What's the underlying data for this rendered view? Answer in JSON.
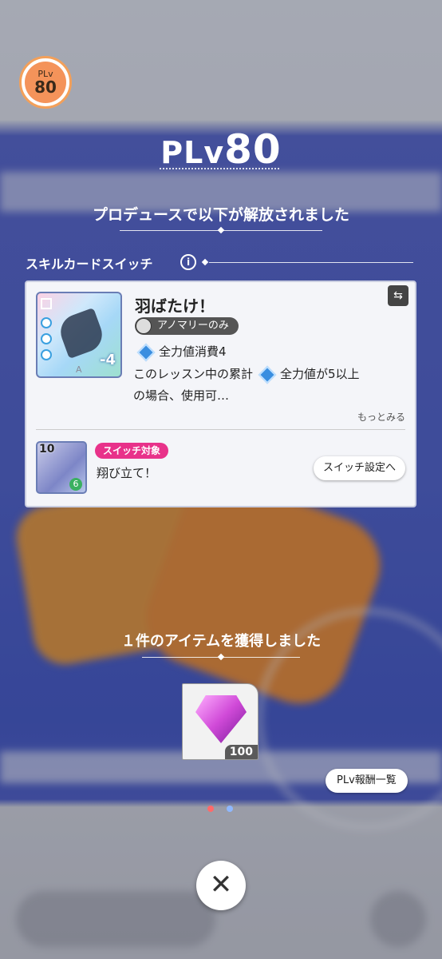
{
  "player_level": {
    "badge_label": "PLv",
    "badge_value": "80",
    "title_prefix": "PLv",
    "title_value": "80"
  },
  "unlock": {
    "heading": "プロデュースで以下が解放されました"
  },
  "section": {
    "label": "スキルカードスイッチ",
    "info_icon": "i"
  },
  "card": {
    "name": "羽ばたけ！",
    "condition_tag": "アノマリーのみ",
    "cost_text": "全力値消費4",
    "desc_line1": "このレッスン中の累計",
    "desc_line1b": "全力値が5以上",
    "desc_line2": "の場合、使用可…",
    "more_link": "もっとみる",
    "image_cost": "-4",
    "image_rarity": "A",
    "switch_icon": "⇆"
  },
  "switch_target": {
    "tag": "スイッチ対象",
    "name": "翔び立て！",
    "level": "10",
    "cost": "6",
    "button_label": "スイッチ設定へ"
  },
  "reward": {
    "heading": "１件のアイテムを獲得しました",
    "item_count": "100"
  },
  "buttons": {
    "rewards_list": "PLv報酬一覧",
    "close": "✕"
  },
  "colors": {
    "accent_pink": "#e8328a",
    "badge_orange": "#f4935a"
  }
}
